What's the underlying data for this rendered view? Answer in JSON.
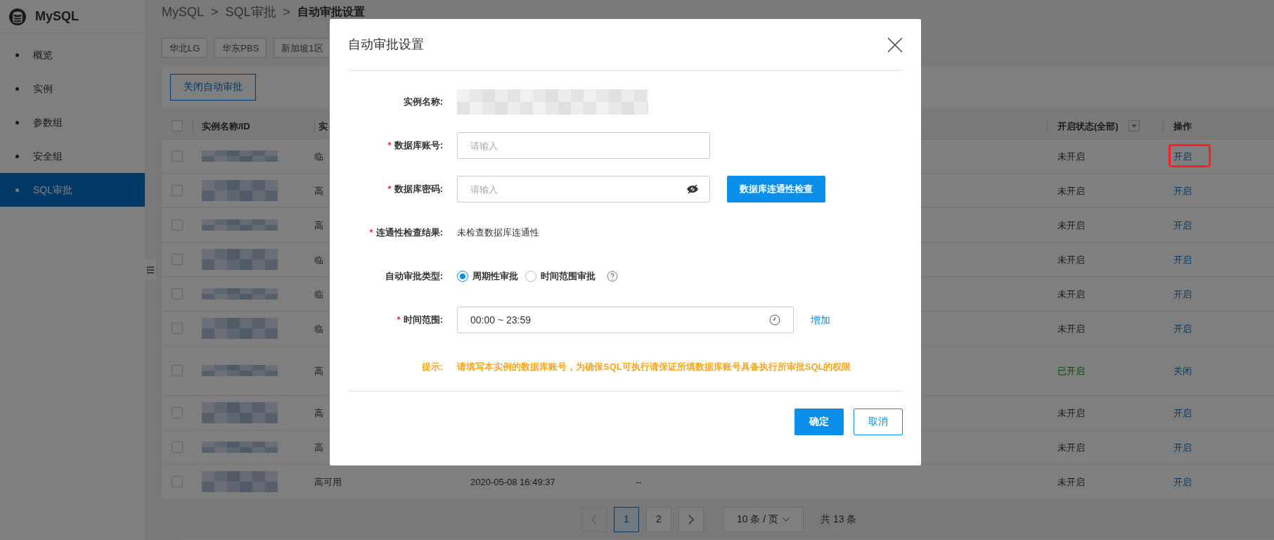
{
  "sidebar": {
    "title": "MySQL",
    "items": [
      {
        "label": "概览",
        "selected": false
      },
      {
        "label": "实例",
        "selected": false
      },
      {
        "label": "参数组",
        "selected": false
      },
      {
        "label": "安全组",
        "selected": false
      },
      {
        "label": "SQL审批",
        "selected": true
      }
    ]
  },
  "breadcrumb": {
    "separator": ">",
    "items": [
      "MySQL",
      "SQL审批",
      "自动审批设置"
    ]
  },
  "region_tabs": [
    "华北LG",
    "华东PBS",
    "新加坡1区"
  ],
  "toolbar_button": "关闭自动审批",
  "table": {
    "select_all_checked": false,
    "columns": {
      "name": "实例名称/ID",
      "type": "实",
      "status": "开启状态(全部)",
      "action": "操作"
    },
    "rows": [
      {
        "checked": false,
        "type": "临",
        "status": "未开启",
        "enabled": false,
        "action": "开启",
        "highlighted": true
      },
      {
        "checked": false,
        "type": "高",
        "status": "未开启",
        "enabled": false,
        "action": "开启",
        "highlighted": false
      },
      {
        "checked": false,
        "type": "高",
        "status": "未开启",
        "enabled": false,
        "action": "开启",
        "highlighted": false
      },
      {
        "checked": false,
        "type": "临",
        "status": "未开启",
        "enabled": false,
        "action": "开启",
        "highlighted": false
      },
      {
        "checked": false,
        "type": "临",
        "status": "未开启",
        "enabled": false,
        "action": "开启",
        "highlighted": false
      },
      {
        "checked": false,
        "type": "临",
        "status": "未开启",
        "enabled": false,
        "action": "开启",
        "highlighted": false
      },
      {
        "checked": false,
        "type": "高",
        "status": "已开启",
        "enabled": true,
        "action": "关闭",
        "highlighted": false,
        "tall": true
      },
      {
        "checked": false,
        "type": "高",
        "status": "未开启",
        "enabled": false,
        "action": "开启",
        "highlighted": false
      },
      {
        "checked": false,
        "type": "高",
        "status": "未开启",
        "enabled": false,
        "action": "开启",
        "highlighted": false
      },
      {
        "checked": false,
        "type": "高可用",
        "created": "2020-05-08 16:49:37",
        "column_5": "--",
        "status": "未开启",
        "enabled": false,
        "action": "开启",
        "highlighted": false
      }
    ]
  },
  "pagination": {
    "pages": [
      {
        "label": "1",
        "selected": true
      },
      {
        "label": "2",
        "selected": false
      }
    ],
    "page_size": "10 条 / 页",
    "total": "共 13 条"
  },
  "dialog": {
    "title": "自动审批设置",
    "required_mark": "*",
    "fields": [
      {
        "kind": "redacted",
        "label": "实例名称:",
        "required": false
      },
      {
        "kind": "input",
        "label": "数据库账号:",
        "required": true,
        "placeholder": "请输入"
      },
      {
        "kind": "password",
        "label": "数据库密码:",
        "required": true,
        "placeholder": "请输入",
        "button": "数据库连通性检查"
      },
      {
        "kind": "text",
        "label": "连通性检查结果:",
        "required": true,
        "value": "未检查数据库连通性"
      },
      {
        "kind": "radio",
        "label": "自动审批类型:",
        "required": false,
        "options": [
          {
            "label": "周期性审批",
            "selected": true
          },
          {
            "label": "时间范围审批",
            "selected": false
          }
        ]
      },
      {
        "kind": "time",
        "label": "时间范围:",
        "required": true,
        "value": "00:00 ~ 23:59",
        "link": "增加"
      }
    ],
    "tip": {
      "label": "提示:",
      "text": "请填写本实例的数据库账号，为确保SQL可执行请保证所填数据库账号具备执行所审批SQL的权限"
    },
    "ok_button": "确定",
    "cancel_button": "取消"
  }
}
